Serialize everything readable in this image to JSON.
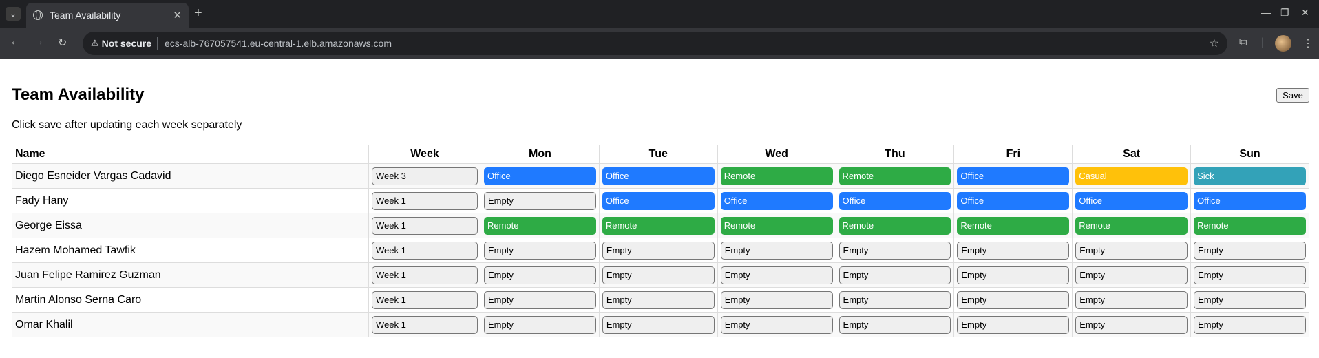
{
  "browser": {
    "tab_title": "Team Availability",
    "security_label": "Not secure",
    "url": "ecs-alb-767057541.eu-central-1.elb.amazonaws.com"
  },
  "page": {
    "title": "Team Availability",
    "subtitle": "Click save after updating each week separately",
    "save_label": "Save"
  },
  "table": {
    "headers": [
      "Name",
      "Week",
      "Mon",
      "Tue",
      "Wed",
      "Thu",
      "Fri",
      "Sat",
      "Sun"
    ],
    "rows": [
      {
        "name": "Diego Esneider Vargas Cadavid",
        "week": "Week 3",
        "days": [
          "Office",
          "Office",
          "Remote",
          "Remote",
          "Office",
          "Casual",
          "Sick"
        ]
      },
      {
        "name": "Fady Hany",
        "week": "Week 1",
        "days": [
          "Empty",
          "Office",
          "Office",
          "Office",
          "Office",
          "Office",
          "Office"
        ]
      },
      {
        "name": "George Eissa",
        "week": "Week 1",
        "days": [
          "Remote",
          "Remote",
          "Remote",
          "Remote",
          "Remote",
          "Remote",
          "Remote"
        ]
      },
      {
        "name": "Hazem Mohamed Tawfik",
        "week": "Week 1",
        "days": [
          "Empty",
          "Empty",
          "Empty",
          "Empty",
          "Empty",
          "Empty",
          "Empty"
        ]
      },
      {
        "name": "Juan Felipe Ramirez Guzman",
        "week": "Week 1",
        "days": [
          "Empty",
          "Empty",
          "Empty",
          "Empty",
          "Empty",
          "Empty",
          "Empty"
        ]
      },
      {
        "name": "Martin Alonso Serna Caro",
        "week": "Week 1",
        "days": [
          "Empty",
          "Empty",
          "Empty",
          "Empty",
          "Empty",
          "Empty",
          "Empty"
        ]
      },
      {
        "name": "Omar Khalil",
        "week": "Week 1",
        "days": [
          "Empty",
          "Empty",
          "Empty",
          "Empty",
          "Empty",
          "Empty",
          "Empty"
        ]
      }
    ]
  },
  "status_colors": {
    "Office": "#1f7aff",
    "Remote": "#2eab45",
    "Casual": "#ffc10a",
    "Sick": "#33a2b8",
    "Empty": "#efefef"
  }
}
